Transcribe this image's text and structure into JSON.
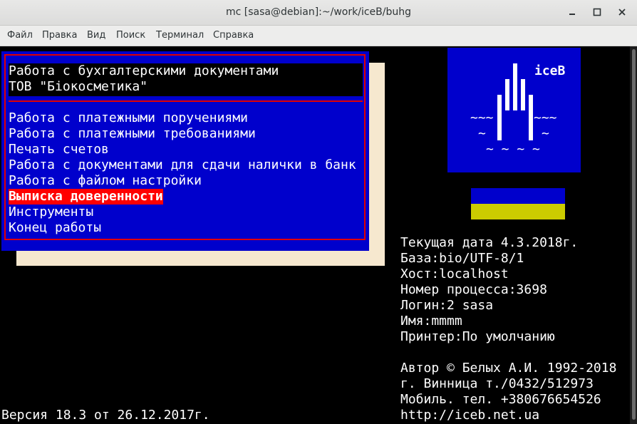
{
  "window": {
    "title": "mc [sasa@debian]:~/work/iceB/buhg"
  },
  "menubar": {
    "items": [
      "Файл",
      "Правка",
      "Вид",
      "Поиск",
      "Терминал",
      "Справка"
    ]
  },
  "dialog": {
    "header_line1": "Работа с бухгалтерскими документами",
    "header_line2": "ТОВ \"Біокосметика\"",
    "items": [
      "Работа с платежными поручениями",
      "Работа с платежными требованиями",
      "Печать счетов",
      "Работа с документами для сдачи налички в банк",
      "Работа с файлом настройки",
      "Выписка доверенности",
      "Инструменты",
      "Конец работы"
    ],
    "selected_index": 5
  },
  "logo": {
    "brand": "iceB",
    "wave_left": "~~~",
    "wave_right": "~~~",
    "tilde_left": "~",
    "tilde_right": "~",
    "bottom_waves": "~ ~ ~ ~"
  },
  "info": {
    "date": "Текущая дата 4.3.2018г.",
    "db": "База:bio/UTF-8/1",
    "host": "Хост:localhost",
    "process": "Номер процесса:3698",
    "login": "Логин:2 sasa",
    "name": "Имя:mmmm",
    "printer": "Принтер:По умолчанию",
    "author": "Автор © Белых А.И. 1992-2018",
    "city": "г. Винница т./0432/512973",
    "mobile": "Мобиль. тел. +380676654526",
    "url": "http://iceb.net.ua"
  },
  "status": {
    "version": "Версия 18.3 от 26.12.2017г."
  },
  "colors": {
    "terminal_bg": "#000000",
    "dialog_bg": "#0000cc",
    "frame_red": "#e00000",
    "selected_bg": "#ff0000",
    "shadow": "#f6e8cf",
    "flag_blue": "#0000cc",
    "flag_yellow": "#cccc00"
  }
}
